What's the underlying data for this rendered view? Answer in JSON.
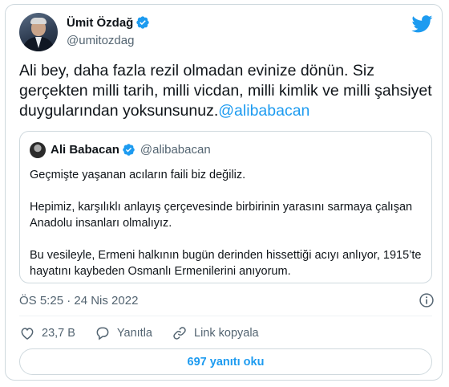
{
  "author": {
    "name": "Ümit Özdağ",
    "handle": "@umitozdag"
  },
  "tweet": {
    "text": "Ali bey, daha fazla rezil olmadan evinize dönün. Siz gerçekten milli tarih, milli vicdan, milli kimlik ve milli şahsiyet duygularından yoksunsunuz.",
    "mention": "@alibabacan"
  },
  "quoted": {
    "name": "Ali Babacan",
    "handle": "@alibabacan",
    "paragraphs": [
      "Geçmişte yaşanan acıların faili biz değiliz.",
      "Hepimiz, karşılıklı anlayış çerçevesinde birbirinin yarasını sarmaya çalışan Anadolu insanları olmalıyız.",
      "Bu vesileyle, Ermeni halkının bugün derinden hissettiği acıyı anlıyor, 1915’te hayatını kaybeden Osmanlı Ermenilerini anıyorum."
    ]
  },
  "meta": {
    "timestamp": "ÖS 5:25 · 24 Nis 2022"
  },
  "actions": {
    "likes": "23,7 B",
    "reply": "Yanıtla",
    "copy_link": "Link kopyala"
  },
  "replies_button": "697 yanıtı oku",
  "colors": {
    "accent": "#1d9bf0",
    "text": "#0f1419",
    "secondary": "#536471",
    "border": "#cfd9de"
  },
  "icons": [
    "verified-badge-icon",
    "twitter-bird-icon",
    "info-icon",
    "heart-icon",
    "reply-bubble-icon",
    "link-icon"
  ]
}
